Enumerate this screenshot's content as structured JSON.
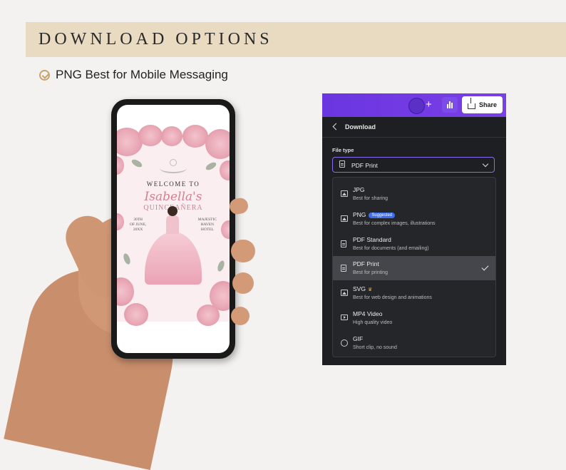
{
  "banner": {
    "title": "DOWNLOAD OPTIONS"
  },
  "subtitle": {
    "text": "PNG Best for Mobile Messaging",
    "check_icon": "check-circle-icon",
    "accent": "#c9a46a"
  },
  "invitation": {
    "welcome": "WELCOME TO",
    "name": "Isabella's",
    "event": "QUINCEAÑERA",
    "date_line1": "30TH",
    "date_line2": "OF JUNE,",
    "date_line3": "20XX",
    "venue_line1": "MAJESTIC",
    "venue_line2": "HAVEN",
    "venue_line3": "HOTEL"
  },
  "canva": {
    "share_label": "Share",
    "panel_title": "Download",
    "file_type_label": "File type",
    "selected_value": "PDF Print",
    "accent": "#7b3fe6",
    "options": [
      {
        "title": "JPG",
        "desc": "Best for sharing",
        "icon": "image-icon"
      },
      {
        "title": "PNG",
        "badge": "Suggested",
        "desc": "Best for complex images, illustrations",
        "icon": "image-icon"
      },
      {
        "title": "PDF Standard",
        "desc": "Best for documents (and emailing)",
        "icon": "document-icon"
      },
      {
        "title": "PDF Print",
        "desc": "Best for printing",
        "icon": "document-icon",
        "selected": true
      },
      {
        "title": "SVG",
        "desc": "Best for web design and animations",
        "icon": "image-icon",
        "pro": true
      },
      {
        "title": "MP4 Video",
        "desc": "High quality video",
        "icon": "video-icon"
      },
      {
        "title": "GIF",
        "desc": "Short clip, no sound",
        "icon": "gif-icon"
      }
    ]
  }
}
